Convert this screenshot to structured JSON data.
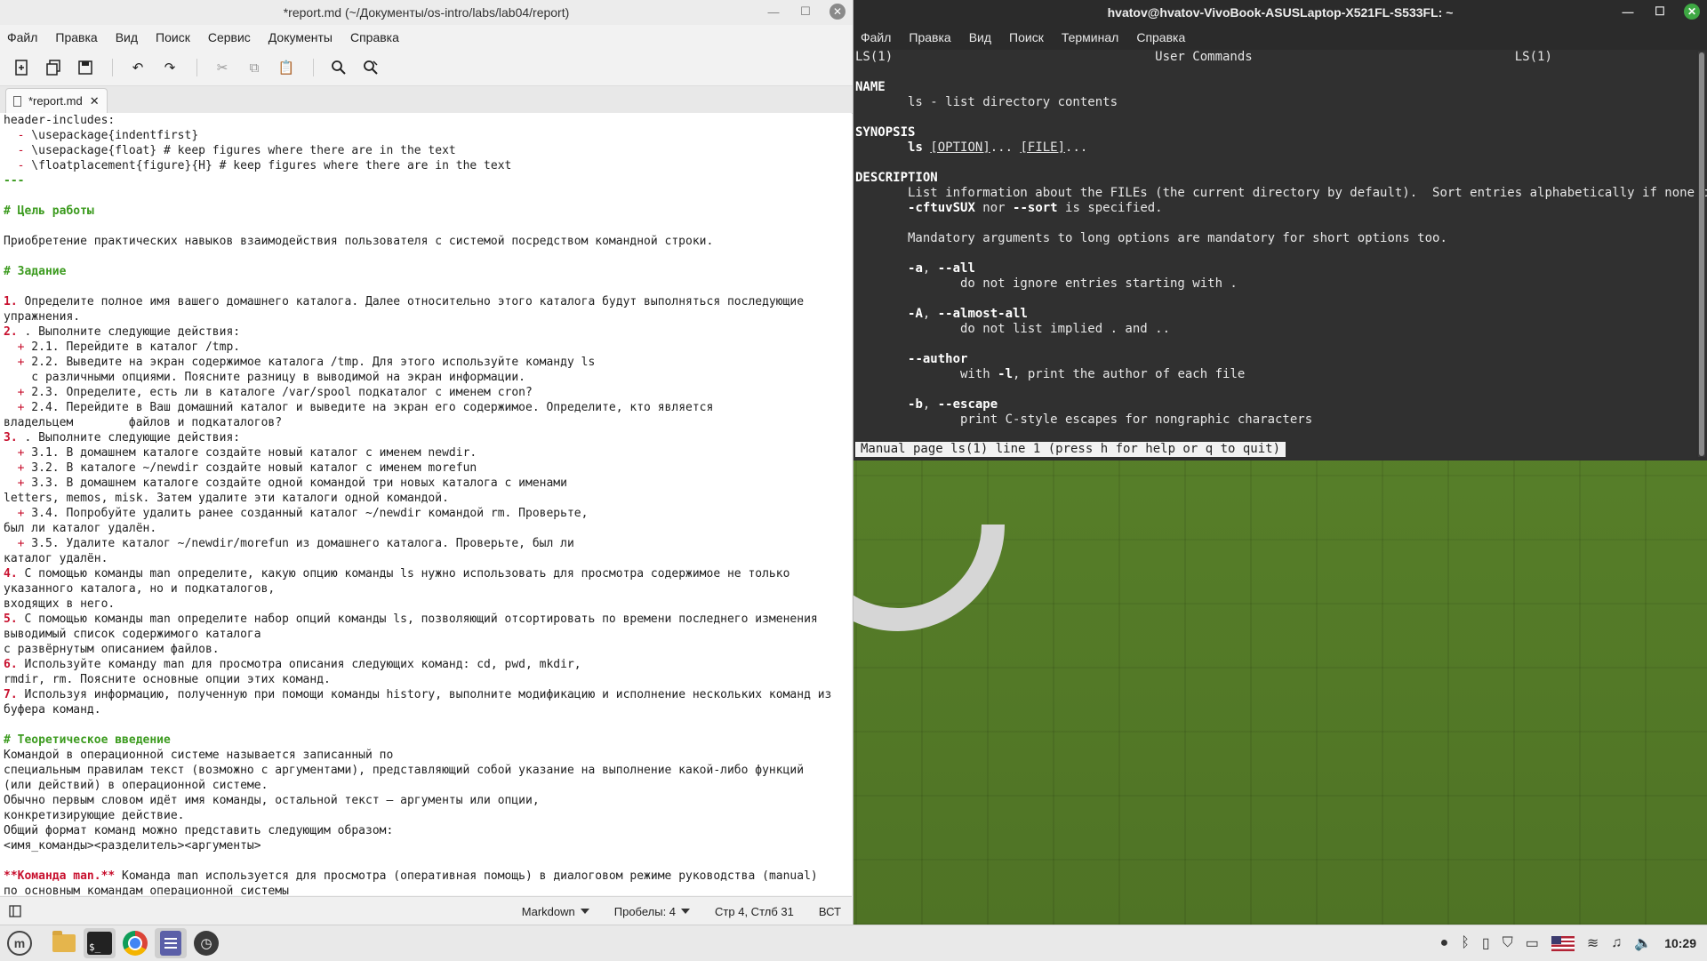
{
  "editor": {
    "title": "*report.md (~/Документы/os-intro/labs/lab04/report)",
    "menu": [
      "Файл",
      "Правка",
      "Вид",
      "Поиск",
      "Сервис",
      "Документы",
      "Справка"
    ],
    "tab_label": "*report.md",
    "status": {
      "language": "Markdown",
      "spaces": "Пробелы: 4",
      "position": "Стр 4, Стлб 31",
      "mode": "ВСТ"
    },
    "lines": [
      [
        {
          "t": "header-includes:"
        }
      ],
      [
        {
          "t": "  "
        },
        {
          "t": "-",
          "c": "plus"
        },
        {
          "t": " \\usepackage{indentfirst}"
        }
      ],
      [
        {
          "t": "  "
        },
        {
          "t": "-",
          "c": "plus"
        },
        {
          "t": " \\usepackage{float} # keep figures where there are in the text"
        }
      ],
      [
        {
          "t": "  "
        },
        {
          "t": "-",
          "c": "plus"
        },
        {
          "t": " \\floatplacement{figure}{H} # keep figures where there are in the text"
        }
      ],
      [
        {
          "t": "---",
          "c": "hd"
        }
      ],
      [
        {
          "t": ""
        }
      ],
      [
        {
          "t": "# Цель работы",
          "c": "hd"
        }
      ],
      [
        {
          "t": ""
        }
      ],
      [
        {
          "t": "Приобретение практических навыков взаимодействия пользователя с системой посредством командной строки."
        }
      ],
      [
        {
          "t": ""
        }
      ],
      [
        {
          "t": "# Задание",
          "c": "hd"
        }
      ],
      [
        {
          "t": ""
        }
      ],
      [
        {
          "t": "1.",
          "c": "num"
        },
        {
          "t": " Определите полное имя вашего домашнего каталога. Далее относительно этого каталога будут выполняться последующие"
        }
      ],
      [
        {
          "t": "упражнения."
        }
      ],
      [
        {
          "t": "2.",
          "c": "num"
        },
        {
          "t": " . Выполните следующие действия:"
        }
      ],
      [
        {
          "t": "  "
        },
        {
          "t": "+",
          "c": "plus"
        },
        {
          "t": " 2.1. Перейдите в каталог /tmp."
        }
      ],
      [
        {
          "t": "  "
        },
        {
          "t": "+",
          "c": "plus"
        },
        {
          "t": " 2.2. Выведите на экран содержимое каталога /tmp. Для этого используйте команду ls"
        }
      ],
      [
        {
          "t": "    с различными опциями. Поясните разницу в выводимой на экран информации."
        }
      ],
      [
        {
          "t": "  "
        },
        {
          "t": "+",
          "c": "plus"
        },
        {
          "t": " 2.3. Определите, есть ли в каталоге /var/spool подкаталог с именем cron?"
        }
      ],
      [
        {
          "t": "  "
        },
        {
          "t": "+",
          "c": "plus"
        },
        {
          "t": " 2.4. Перейдите в Ваш домашний каталог и выведите на экран его содержимое. Определите, кто является"
        }
      ],
      [
        {
          "t": "владельцем        файлов и подкаталогов?"
        }
      ],
      [
        {
          "t": "3.",
          "c": "num"
        },
        {
          "t": " . Выполните следующие действия:"
        }
      ],
      [
        {
          "t": "  "
        },
        {
          "t": "+",
          "c": "plus"
        },
        {
          "t": " 3.1. В домашнем каталоге создайте новый каталог с именем newdir."
        }
      ],
      [
        {
          "t": "  "
        },
        {
          "t": "+",
          "c": "plus"
        },
        {
          "t": " 3.2. В каталоге ~/newdir создайте новый каталог с именем morefun"
        }
      ],
      [
        {
          "t": "  "
        },
        {
          "t": "+",
          "c": "plus"
        },
        {
          "t": " 3.3. В домашнем каталоге создайте одной командой три новых каталога с именами"
        }
      ],
      [
        {
          "t": "letters, memos, misk. Затем удалите эти каталоги одной командой."
        }
      ],
      [
        {
          "t": "  "
        },
        {
          "t": "+",
          "c": "plus"
        },
        {
          "t": " 3.4. Попробуйте удалить ранее созданный каталог ~/newdir командой rm. Проверьте,"
        }
      ],
      [
        {
          "t": "был ли каталог удалён."
        }
      ],
      [
        {
          "t": "  "
        },
        {
          "t": "+",
          "c": "plus"
        },
        {
          "t": " 3.5. Удалите каталог ~/newdir/morefun из домашнего каталога. Проверьте, был ли"
        }
      ],
      [
        {
          "t": "каталог удалён."
        }
      ],
      [
        {
          "t": "4.",
          "c": "num"
        },
        {
          "t": " С помощью команды man определите, какую опцию команды ls нужно использовать для просмотра содержимое не только"
        }
      ],
      [
        {
          "t": "указанного каталога, но и подкаталогов,"
        }
      ],
      [
        {
          "t": "входящих в него."
        }
      ],
      [
        {
          "t": "5.",
          "c": "num"
        },
        {
          "t": " С помощью команды man определите набор опций команды ls, позволяющий отсортировать по времени последнего изменения"
        }
      ],
      [
        {
          "t": "выводимый список содержимого каталога"
        }
      ],
      [
        {
          "t": "с развёрнутым описанием файлов."
        }
      ],
      [
        {
          "t": "6.",
          "c": "num"
        },
        {
          "t": " Используйте команду man для просмотра описания следующих команд: cd, pwd, mkdir,"
        }
      ],
      [
        {
          "t": "rmdir, rm. Поясните основные опции этих команд."
        }
      ],
      [
        {
          "t": "7.",
          "c": "num"
        },
        {
          "t": " Используя информацию, полученную при помощи команды history, выполните модификацию и исполнение нескольких команд из"
        }
      ],
      [
        {
          "t": "буфера команд."
        }
      ],
      [
        {
          "t": ""
        }
      ],
      [
        {
          "t": "# Теоретическое введение",
          "c": "hd"
        }
      ],
      [
        {
          "t": "Командой в операционной системе называется записанный по"
        }
      ],
      [
        {
          "t": "специальным правилам текст (возможно с аргументами), представляющий собой указание на выполнение какой-либо функций"
        }
      ],
      [
        {
          "t": "(или действий) в операционной системе."
        }
      ],
      [
        {
          "t": "Обычно первым словом идёт имя команды, остальной текст — аргументы или опции,"
        }
      ],
      [
        {
          "t": "конкретизирующие действие."
        }
      ],
      [
        {
          "t": "Общий формат команд можно представить следующим образом:"
        }
      ],
      [
        {
          "t": "<имя_команды><разделитель><аргументы>"
        }
      ],
      [
        {
          "t": ""
        }
      ],
      [
        {
          "t": "**Команда man.**",
          "c": "bold"
        },
        {
          "t": " Команда man используется для просмотра (оперативная помощь) в диалоговом режиме руководства (manual)"
        }
      ],
      [
        {
          "t": "по основным командам операционной системы"
        }
      ]
    ]
  },
  "terminal": {
    "title": "hvatov@hvatov-VivoBook-ASUSLaptop-X521FL-S533FL: ~",
    "menu": [
      "Файл",
      "Правка",
      "Вид",
      "Поиск",
      "Терминал",
      "Справка"
    ],
    "lines": [
      [
        {
          "t": "LS(1)                                   User Commands                                   LS(1)"
        }
      ],
      [
        {
          "t": ""
        }
      ],
      [
        {
          "t": "NAME",
          "c": "tb-bold"
        }
      ],
      [
        {
          "t": "       ls - list directory contents"
        }
      ],
      [
        {
          "t": ""
        }
      ],
      [
        {
          "t": "SYNOPSIS",
          "c": "tb-bold"
        }
      ],
      [
        {
          "t": "       "
        },
        {
          "t": "ls",
          "c": "tb-bold"
        },
        {
          "t": " "
        },
        {
          "t": "[OPTION]",
          "c": "ul"
        },
        {
          "t": "... "
        },
        {
          "t": "[FILE]",
          "c": "ul"
        },
        {
          "t": "..."
        }
      ],
      [
        {
          "t": ""
        }
      ],
      [
        {
          "t": "DESCRIPTION",
          "c": "tb-bold"
        }
      ],
      [
        {
          "t": "       List information about the FILEs (the current directory by default).  Sort entries alphabetically if none of"
        }
      ],
      [
        {
          "t": "       "
        },
        {
          "t": "-cftuvSUX",
          "c": "tb-bold"
        },
        {
          "t": " nor "
        },
        {
          "t": "--sort",
          "c": "tb-bold"
        },
        {
          "t": " is specified."
        }
      ],
      [
        {
          "t": ""
        }
      ],
      [
        {
          "t": "       Mandatory arguments to long options are mandatory for short options too."
        }
      ],
      [
        {
          "t": ""
        }
      ],
      [
        {
          "t": "       "
        },
        {
          "t": "-a",
          "c": "tb-bold"
        },
        {
          "t": ", "
        },
        {
          "t": "--all",
          "c": "tb-bold"
        }
      ],
      [
        {
          "t": "              do not ignore entries starting with ."
        }
      ],
      [
        {
          "t": ""
        }
      ],
      [
        {
          "t": "       "
        },
        {
          "t": "-A",
          "c": "tb-bold"
        },
        {
          "t": ", "
        },
        {
          "t": "--almost-all",
          "c": "tb-bold"
        }
      ],
      [
        {
          "t": "              do not list implied . and .."
        }
      ],
      [
        {
          "t": ""
        }
      ],
      [
        {
          "t": "       "
        },
        {
          "t": "--author",
          "c": "tb-bold"
        }
      ],
      [
        {
          "t": "              with "
        },
        {
          "t": "-l",
          "c": "tb-bold"
        },
        {
          "t": ", print the author of each file"
        }
      ],
      [
        {
          "t": ""
        }
      ],
      [
        {
          "t": "       "
        },
        {
          "t": "-b",
          "c": "tb-bold"
        },
        {
          "t": ", "
        },
        {
          "t": "--escape",
          "c": "tb-bold"
        }
      ],
      [
        {
          "t": "              print C-style escapes for nongraphic characters"
        }
      ]
    ],
    "status": "Manual page ls(1) line 1 (press h for help or q to quit)"
  },
  "taskbar": {
    "apps": [
      "mint-menu-icon",
      "files-icon",
      "terminal-icon",
      "chrome-icon",
      "text-editor-icon",
      "clock-app-icon"
    ],
    "clock": "10:29"
  }
}
